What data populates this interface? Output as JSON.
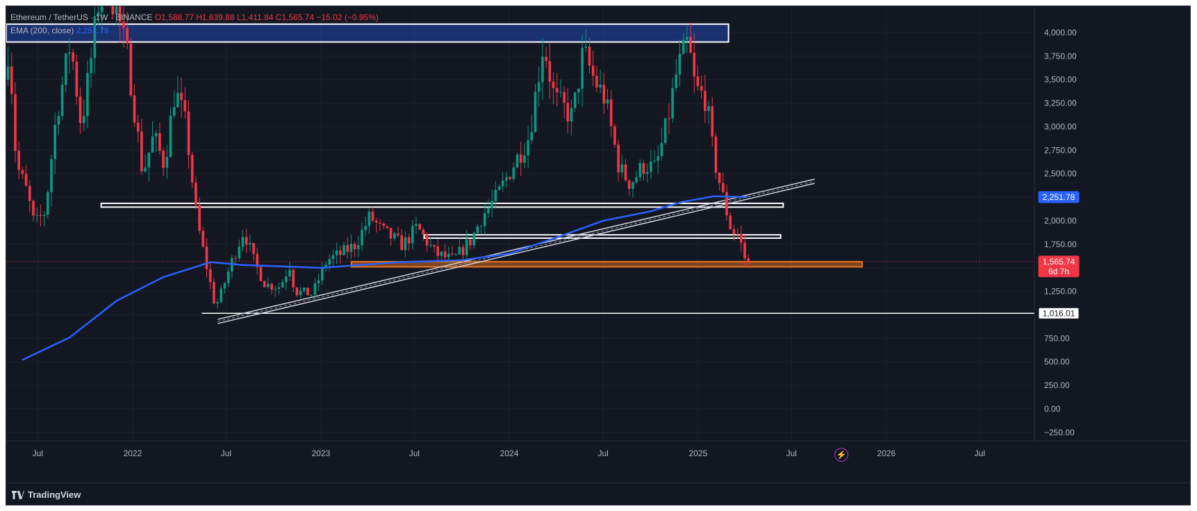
{
  "legend": {
    "symbol": "Ethereum / TetherUS · 1W · BINANCE",
    "ohlc": "O1,588.77 H1,639.88 L1,411.84 C1,565.74 −15.02 (−0.95%)",
    "ema_label": "EMA (200, close)",
    "ema_value": "2,251.78"
  },
  "footer": {
    "brand": "TradingView"
  },
  "colors": {
    "up": "#089981",
    "down": "#f23645",
    "ema": "#2962ff",
    "zone": "#e8741f",
    "background": "#131722",
    "grid": "#1e222d",
    "axis_text": "#b2b5be"
  },
  "chart_data": {
    "type": "candlestick",
    "y_ticks": [
      4000,
      3750,
      3500,
      3250,
      3000,
      2750,
      2500,
      2250,
      2000,
      1750,
      1500,
      1250,
      1000,
      750,
      500,
      250,
      0,
      -250
    ],
    "y_tick_labels": [
      "4,000.00",
      "3,750.00",
      "3,500.00",
      "3,250.00",
      "3,000.00",
      "2,750.00",
      "2,500.00",
      "2,250.00",
      "2,000.00",
      "1,750.00",
      "1,500.00",
      "1,250.00",
      "1,000.00",
      "750.00",
      "500.00",
      "250.00",
      "0.00",
      "−250.00"
    ],
    "ylim": [
      -340,
      4280
    ],
    "x_start": "2021-05-01",
    "x_end": "2026-10-15",
    "x_ticks": [
      {
        "date": "2021-07-01",
        "label": "Jul"
      },
      {
        "date": "2022-01-01",
        "label": "2022"
      },
      {
        "date": "2022-07-01",
        "label": "Jul"
      },
      {
        "date": "2023-01-01",
        "label": "2023"
      },
      {
        "date": "2023-07-01",
        "label": "Jul"
      },
      {
        "date": "2024-01-01",
        "label": "2024"
      },
      {
        "date": "2024-07-01",
        "label": "Jul"
      },
      {
        "date": "2025-01-01",
        "label": "2025"
      },
      {
        "date": "2025-07-01",
        "label": "Jul"
      },
      {
        "date": "2026-01-01",
        "label": "2026"
      },
      {
        "date": "2026-07-01",
        "label": "Jul"
      }
    ],
    "price_path": [
      [
        "2021-05-01",
        3500
      ],
      [
        "2021-05-10",
        3900
      ],
      [
        "2021-05-24",
        2600
      ],
      [
        "2021-06-14",
        2300
      ],
      [
        "2021-06-28",
        1950
      ],
      [
        "2021-07-19",
        2100
      ],
      [
        "2021-08-09",
        3100
      ],
      [
        "2021-09-06",
        3900
      ],
      [
        "2021-09-27",
        3000
      ],
      [
        "2021-10-18",
        3800
      ],
      [
        "2021-11-08",
        4700
      ],
      [
        "2021-12-06",
        4200
      ],
      [
        "2021-12-27",
        3700
      ],
      [
        "2022-01-24",
        2500
      ],
      [
        "2022-02-14",
        2900
      ],
      [
        "2022-03-07",
        2600
      ],
      [
        "2022-03-28",
        3400
      ],
      [
        "2022-04-18",
        3000
      ],
      [
        "2022-05-09",
        2000
      ],
      [
        "2022-06-13",
        1100
      ],
      [
        "2022-06-20",
        1150
      ],
      [
        "2022-07-18",
        1600
      ],
      [
        "2022-08-08",
        1900
      ],
      [
        "2022-08-29",
        1550
      ],
      [
        "2022-09-19",
        1320
      ],
      [
        "2022-10-17",
        1300
      ],
      [
        "2022-11-07",
        1550
      ],
      [
        "2022-11-14",
        1250
      ],
      [
        "2022-12-19",
        1220
      ],
      [
        "2023-01-16",
        1580
      ],
      [
        "2023-02-13",
        1650
      ],
      [
        "2023-03-13",
        1750
      ],
      [
        "2023-04-10",
        2050
      ],
      [
        "2023-05-01",
        1900
      ],
      [
        "2023-06-12",
        1740
      ],
      [
        "2023-07-10",
        1930
      ],
      [
        "2023-08-14",
        1650
      ],
      [
        "2023-09-18",
        1580
      ],
      [
        "2023-10-23",
        1800
      ],
      [
        "2023-11-13",
        2050
      ],
      [
        "2023-12-11",
        2250
      ],
      [
        "2024-01-08",
        2550
      ],
      [
        "2024-02-12",
        2900
      ],
      [
        "2024-03-11",
        3900
      ],
      [
        "2024-04-01",
        3300
      ],
      [
        "2024-05-06",
        3100
      ],
      [
        "2024-05-27",
        3800
      ],
      [
        "2024-06-17",
        3500
      ],
      [
        "2024-07-08",
        3300
      ],
      [
        "2024-08-05",
        2550
      ],
      [
        "2024-08-26",
        2400
      ],
      [
        "2024-09-23",
        2600
      ],
      [
        "2024-10-14",
        2550
      ],
      [
        "2024-11-04",
        3000
      ],
      [
        "2024-11-25",
        3600
      ],
      [
        "2024-12-16",
        3900
      ],
      [
        "2024-12-30",
        3400
      ],
      [
        "2025-01-20",
        3300
      ],
      [
        "2025-02-03",
        2700
      ],
      [
        "2025-02-24",
        2200
      ],
      [
        "2025-03-10",
        1900
      ],
      [
        "2025-03-24",
        1850
      ],
      [
        "2025-04-07",
        1565.74
      ]
    ],
    "ema_path": [
      [
        "2021-06-01",
        520
      ],
      [
        "2021-09-01",
        760
      ],
      [
        "2021-12-01",
        1150
      ],
      [
        "2022-03-01",
        1400
      ],
      [
        "2022-06-01",
        1560
      ],
      [
        "2022-08-01",
        1530
      ],
      [
        "2023-01-01",
        1500
      ],
      [
        "2023-06-01",
        1560
      ],
      [
        "2023-10-01",
        1580
      ],
      [
        "2024-01-01",
        1650
      ],
      [
        "2024-04-01",
        1820
      ],
      [
        "2024-07-01",
        2000
      ],
      [
        "2024-10-01",
        2100
      ],
      [
        "2024-12-01",
        2200
      ],
      [
        "2025-02-01",
        2260
      ],
      [
        "2025-04-07",
        2251.78
      ]
    ],
    "levels": [
      {
        "type": "box",
        "x0": "2021-05-01",
        "x1": "2025-03-01",
        "y0": 3900,
        "y1": 4090,
        "fill": "rgba(41,98,255,0.35)"
      },
      {
        "type": "box",
        "x0": "2021-11-01",
        "x1": "2025-06-15",
        "y0": 2145,
        "y1": 2185,
        "fill": "none"
      },
      {
        "type": "box",
        "x0": "2023-07-20",
        "x1": "2025-06-10",
        "y0": 1815,
        "y1": 1850,
        "fill": "none"
      },
      {
        "type": "box",
        "x0": "2023-03-01",
        "x1": "2025-11-15",
        "y0": 1510,
        "y1": 1565,
        "fill": "rgba(232,116,31,0.5)",
        "stroke": "#e8741f"
      },
      {
        "type": "line",
        "x0": "2022-05-15",
        "x1": "2026-10-15",
        "y": 1016.01
      }
    ],
    "trendline": {
      "x0": "2022-06-15",
      "y0": 930,
      "x1": "2025-08-15",
      "y1": 2420
    },
    "last_price": {
      "value": 1565.74,
      "label": "1,565.74",
      "countdown": "6d 7h"
    },
    "ema_label_value": {
      "value": 2251.78,
      "label": "2,251.78"
    },
    "level_label": {
      "value": 1016.01,
      "label": "1,016.01"
    },
    "grid": true
  }
}
